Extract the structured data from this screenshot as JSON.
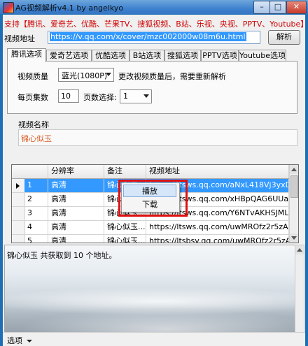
{
  "window": {
    "title": "AG视频解析v4.1 by angelkyo",
    "minimize": "–",
    "maximize": "□",
    "close": "✕"
  },
  "support_text": "支持【腾讯、爱奇艺、优酷、芒果TV、搜狐视频、B站、乐视、央视、PPTV、Youtube】",
  "url": {
    "label": "视频地址",
    "value": "https://v.qq.com/x/cover/mzc002000w08m6u.html",
    "parse_button": "解析"
  },
  "tabs": [
    "腾讯选项",
    "爱奇艺选项",
    "优酷选项",
    "B站选项",
    "搜狐选项",
    "PPTV选项",
    "Youtube选项"
  ],
  "options": {
    "quality_label": "视频质量",
    "quality_value": "蓝光(1080P)",
    "quality_hint": "更改视频质量后，需要重新解析",
    "per_page_label": "每页集数",
    "per_page_value": "10",
    "page_select_label": "页数选择:",
    "page_select_value": "1"
  },
  "video": {
    "name_label": "视频名称",
    "name_value": "锦心似玉"
  },
  "grid": {
    "columns": [
      "分辨率",
      "备注",
      "视频地址"
    ],
    "rows": [
      {
        "num": "1",
        "res": "高清",
        "note": "锦心似玉...",
        "url": "https://ltsws.qq.com/aNxL418Vj3yxDb..."
      },
      {
        "num": "2",
        "res": "高清",
        "note": "锦心似玉...",
        "url": "https://ltsws.qq.com/xHBpQAG6UUap..."
      },
      {
        "num": "3",
        "res": "高清",
        "note": "锦心似玉...",
        "url": "https://ltsws.qq.com/Y6NTvAKHSJML..."
      },
      {
        "num": "4",
        "res": "高清",
        "note": "锦心似玉...",
        "url": "https://ltsws.qq.com/uwMROfz2r5zAc..."
      },
      {
        "num": "5",
        "res": "高清",
        "note": "锦心似玉...",
        "url": "https://ltsbsv.qq.com/uwMROfz2r5zAc..."
      }
    ]
  },
  "context_menu": {
    "play": "播放",
    "download": "下载"
  },
  "log_text": "锦心似玉 共获取到 10 个地址。",
  "status": {
    "dropdown_label": "选项"
  }
}
